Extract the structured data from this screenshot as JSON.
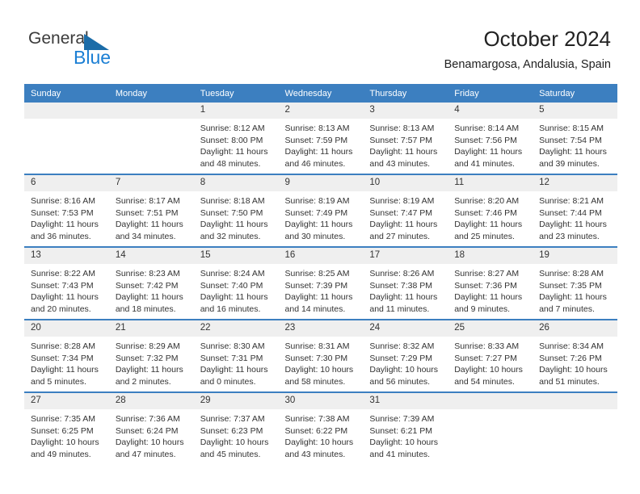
{
  "brand": {
    "name_part1": "General",
    "name_part2": "Blue",
    "accent_color": "#1b7fd4",
    "triangle_color": "#1b6ca8"
  },
  "header": {
    "title": "October 2024",
    "subtitle": "Benamargosa, Andalusia, Spain"
  },
  "calendar": {
    "header_color": "#3c7fc0",
    "daynum_band_color": "#efefef",
    "weekdays": [
      "Sunday",
      "Monday",
      "Tuesday",
      "Wednesday",
      "Thursday",
      "Friday",
      "Saturday"
    ],
    "weeks": [
      [
        {
          "day": "",
          "lines": []
        },
        {
          "day": "",
          "lines": []
        },
        {
          "day": "1",
          "lines": [
            "Sunrise: 8:12 AM",
            "Sunset: 8:00 PM",
            "Daylight: 11 hours and 48 minutes."
          ]
        },
        {
          "day": "2",
          "lines": [
            "Sunrise: 8:13 AM",
            "Sunset: 7:59 PM",
            "Daylight: 11 hours and 46 minutes."
          ]
        },
        {
          "day": "3",
          "lines": [
            "Sunrise: 8:13 AM",
            "Sunset: 7:57 PM",
            "Daylight: 11 hours and 43 minutes."
          ]
        },
        {
          "day": "4",
          "lines": [
            "Sunrise: 8:14 AM",
            "Sunset: 7:56 PM",
            "Daylight: 11 hours and 41 minutes."
          ]
        },
        {
          "day": "5",
          "lines": [
            "Sunrise: 8:15 AM",
            "Sunset: 7:54 PM",
            "Daylight: 11 hours and 39 minutes."
          ]
        }
      ],
      [
        {
          "day": "6",
          "lines": [
            "Sunrise: 8:16 AM",
            "Sunset: 7:53 PM",
            "Daylight: 11 hours and 36 minutes."
          ]
        },
        {
          "day": "7",
          "lines": [
            "Sunrise: 8:17 AM",
            "Sunset: 7:51 PM",
            "Daylight: 11 hours and 34 minutes."
          ]
        },
        {
          "day": "8",
          "lines": [
            "Sunrise: 8:18 AM",
            "Sunset: 7:50 PM",
            "Daylight: 11 hours and 32 minutes."
          ]
        },
        {
          "day": "9",
          "lines": [
            "Sunrise: 8:19 AM",
            "Sunset: 7:49 PM",
            "Daylight: 11 hours and 30 minutes."
          ]
        },
        {
          "day": "10",
          "lines": [
            "Sunrise: 8:19 AM",
            "Sunset: 7:47 PM",
            "Daylight: 11 hours and 27 minutes."
          ]
        },
        {
          "day": "11",
          "lines": [
            "Sunrise: 8:20 AM",
            "Sunset: 7:46 PM",
            "Daylight: 11 hours and 25 minutes."
          ]
        },
        {
          "day": "12",
          "lines": [
            "Sunrise: 8:21 AM",
            "Sunset: 7:44 PM",
            "Daylight: 11 hours and 23 minutes."
          ]
        }
      ],
      [
        {
          "day": "13",
          "lines": [
            "Sunrise: 8:22 AM",
            "Sunset: 7:43 PM",
            "Daylight: 11 hours and 20 minutes."
          ]
        },
        {
          "day": "14",
          "lines": [
            "Sunrise: 8:23 AM",
            "Sunset: 7:42 PM",
            "Daylight: 11 hours and 18 minutes."
          ]
        },
        {
          "day": "15",
          "lines": [
            "Sunrise: 8:24 AM",
            "Sunset: 7:40 PM",
            "Daylight: 11 hours and 16 minutes."
          ]
        },
        {
          "day": "16",
          "lines": [
            "Sunrise: 8:25 AM",
            "Sunset: 7:39 PM",
            "Daylight: 11 hours and 14 minutes."
          ]
        },
        {
          "day": "17",
          "lines": [
            "Sunrise: 8:26 AM",
            "Sunset: 7:38 PM",
            "Daylight: 11 hours and 11 minutes."
          ]
        },
        {
          "day": "18",
          "lines": [
            "Sunrise: 8:27 AM",
            "Sunset: 7:36 PM",
            "Daylight: 11 hours and 9 minutes."
          ]
        },
        {
          "day": "19",
          "lines": [
            "Sunrise: 8:28 AM",
            "Sunset: 7:35 PM",
            "Daylight: 11 hours and 7 minutes."
          ]
        }
      ],
      [
        {
          "day": "20",
          "lines": [
            "Sunrise: 8:28 AM",
            "Sunset: 7:34 PM",
            "Daylight: 11 hours and 5 minutes."
          ]
        },
        {
          "day": "21",
          "lines": [
            "Sunrise: 8:29 AM",
            "Sunset: 7:32 PM",
            "Daylight: 11 hours and 2 minutes."
          ]
        },
        {
          "day": "22",
          "lines": [
            "Sunrise: 8:30 AM",
            "Sunset: 7:31 PM",
            "Daylight: 11 hours and 0 minutes."
          ]
        },
        {
          "day": "23",
          "lines": [
            "Sunrise: 8:31 AM",
            "Sunset: 7:30 PM",
            "Daylight: 10 hours and 58 minutes."
          ]
        },
        {
          "day": "24",
          "lines": [
            "Sunrise: 8:32 AM",
            "Sunset: 7:29 PM",
            "Daylight: 10 hours and 56 minutes."
          ]
        },
        {
          "day": "25",
          "lines": [
            "Sunrise: 8:33 AM",
            "Sunset: 7:27 PM",
            "Daylight: 10 hours and 54 minutes."
          ]
        },
        {
          "day": "26",
          "lines": [
            "Sunrise: 8:34 AM",
            "Sunset: 7:26 PM",
            "Daylight: 10 hours and 51 minutes."
          ]
        }
      ],
      [
        {
          "day": "27",
          "lines": [
            "Sunrise: 7:35 AM",
            "Sunset: 6:25 PM",
            "Daylight: 10 hours and 49 minutes."
          ]
        },
        {
          "day": "28",
          "lines": [
            "Sunrise: 7:36 AM",
            "Sunset: 6:24 PM",
            "Daylight: 10 hours and 47 minutes."
          ]
        },
        {
          "day": "29",
          "lines": [
            "Sunrise: 7:37 AM",
            "Sunset: 6:23 PM",
            "Daylight: 10 hours and 45 minutes."
          ]
        },
        {
          "day": "30",
          "lines": [
            "Sunrise: 7:38 AM",
            "Sunset: 6:22 PM",
            "Daylight: 10 hours and 43 minutes."
          ]
        },
        {
          "day": "31",
          "lines": [
            "Sunrise: 7:39 AM",
            "Sunset: 6:21 PM",
            "Daylight: 10 hours and 41 minutes."
          ]
        },
        {
          "day": "",
          "lines": []
        },
        {
          "day": "",
          "lines": []
        }
      ]
    ]
  }
}
